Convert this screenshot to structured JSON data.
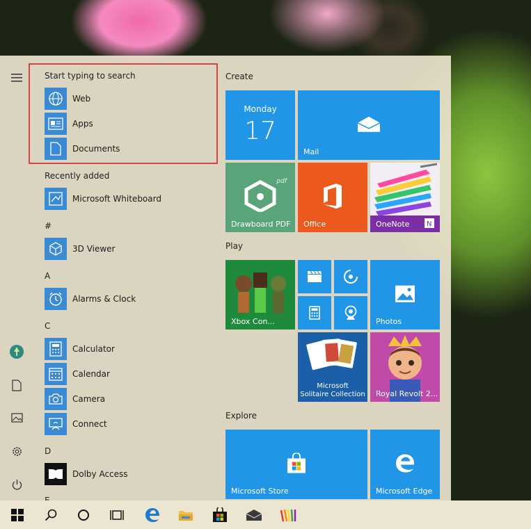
{
  "search_panel": {
    "title": "Start typing to search",
    "items": [
      {
        "label": "Web",
        "icon": "globe-icon"
      },
      {
        "label": "Apps",
        "icon": "app-window-icon"
      },
      {
        "label": "Documents",
        "icon": "document-icon"
      }
    ]
  },
  "recently_added": {
    "title": "Recently added",
    "items": [
      {
        "label": "Microsoft Whiteboard",
        "icon": "whiteboard-icon"
      }
    ]
  },
  "app_sections": [
    {
      "letter": "#",
      "items": [
        {
          "label": "3D Viewer",
          "icon": "cube-icon"
        }
      ]
    },
    {
      "letter": "A",
      "items": [
        {
          "label": "Alarms & Clock",
          "icon": "clock-icon"
        }
      ]
    },
    {
      "letter": "C",
      "items": [
        {
          "label": "Calculator",
          "icon": "calculator-icon"
        },
        {
          "label": "Calendar",
          "icon": "calendar-icon"
        },
        {
          "label": "Camera",
          "icon": "camera-icon"
        },
        {
          "label": "Connect",
          "icon": "connect-icon"
        }
      ]
    },
    {
      "letter": "D",
      "items": [
        {
          "label": "Dolby Access",
          "icon": "dolby-icon"
        }
      ]
    },
    {
      "letter": "E",
      "items": []
    }
  ],
  "groups": {
    "create": "Create",
    "play": "Play",
    "explore": "Explore"
  },
  "tiles": {
    "calendar_day": "Monday",
    "calendar_date": "17",
    "mail": "Mail",
    "drawboard": "Drawboard PDF",
    "office": "Office",
    "onenote": "OneNote",
    "xbox": "Xbox Con...",
    "photos": "Photos",
    "solitaire_line1": "Microsoft",
    "solitaire_line2": "Solitaire Collection",
    "royal": "Royal Revolt 2...",
    "store": "Microsoft Store",
    "edge": "Microsoft Edge"
  },
  "colors": {
    "accent": "#1a8fe0",
    "tile_blue": "#2196e6",
    "office": "#eb5a1c",
    "drawboard": "#5aa47a",
    "xbox": "#1f8a3b",
    "search_outline": "#d64545"
  }
}
